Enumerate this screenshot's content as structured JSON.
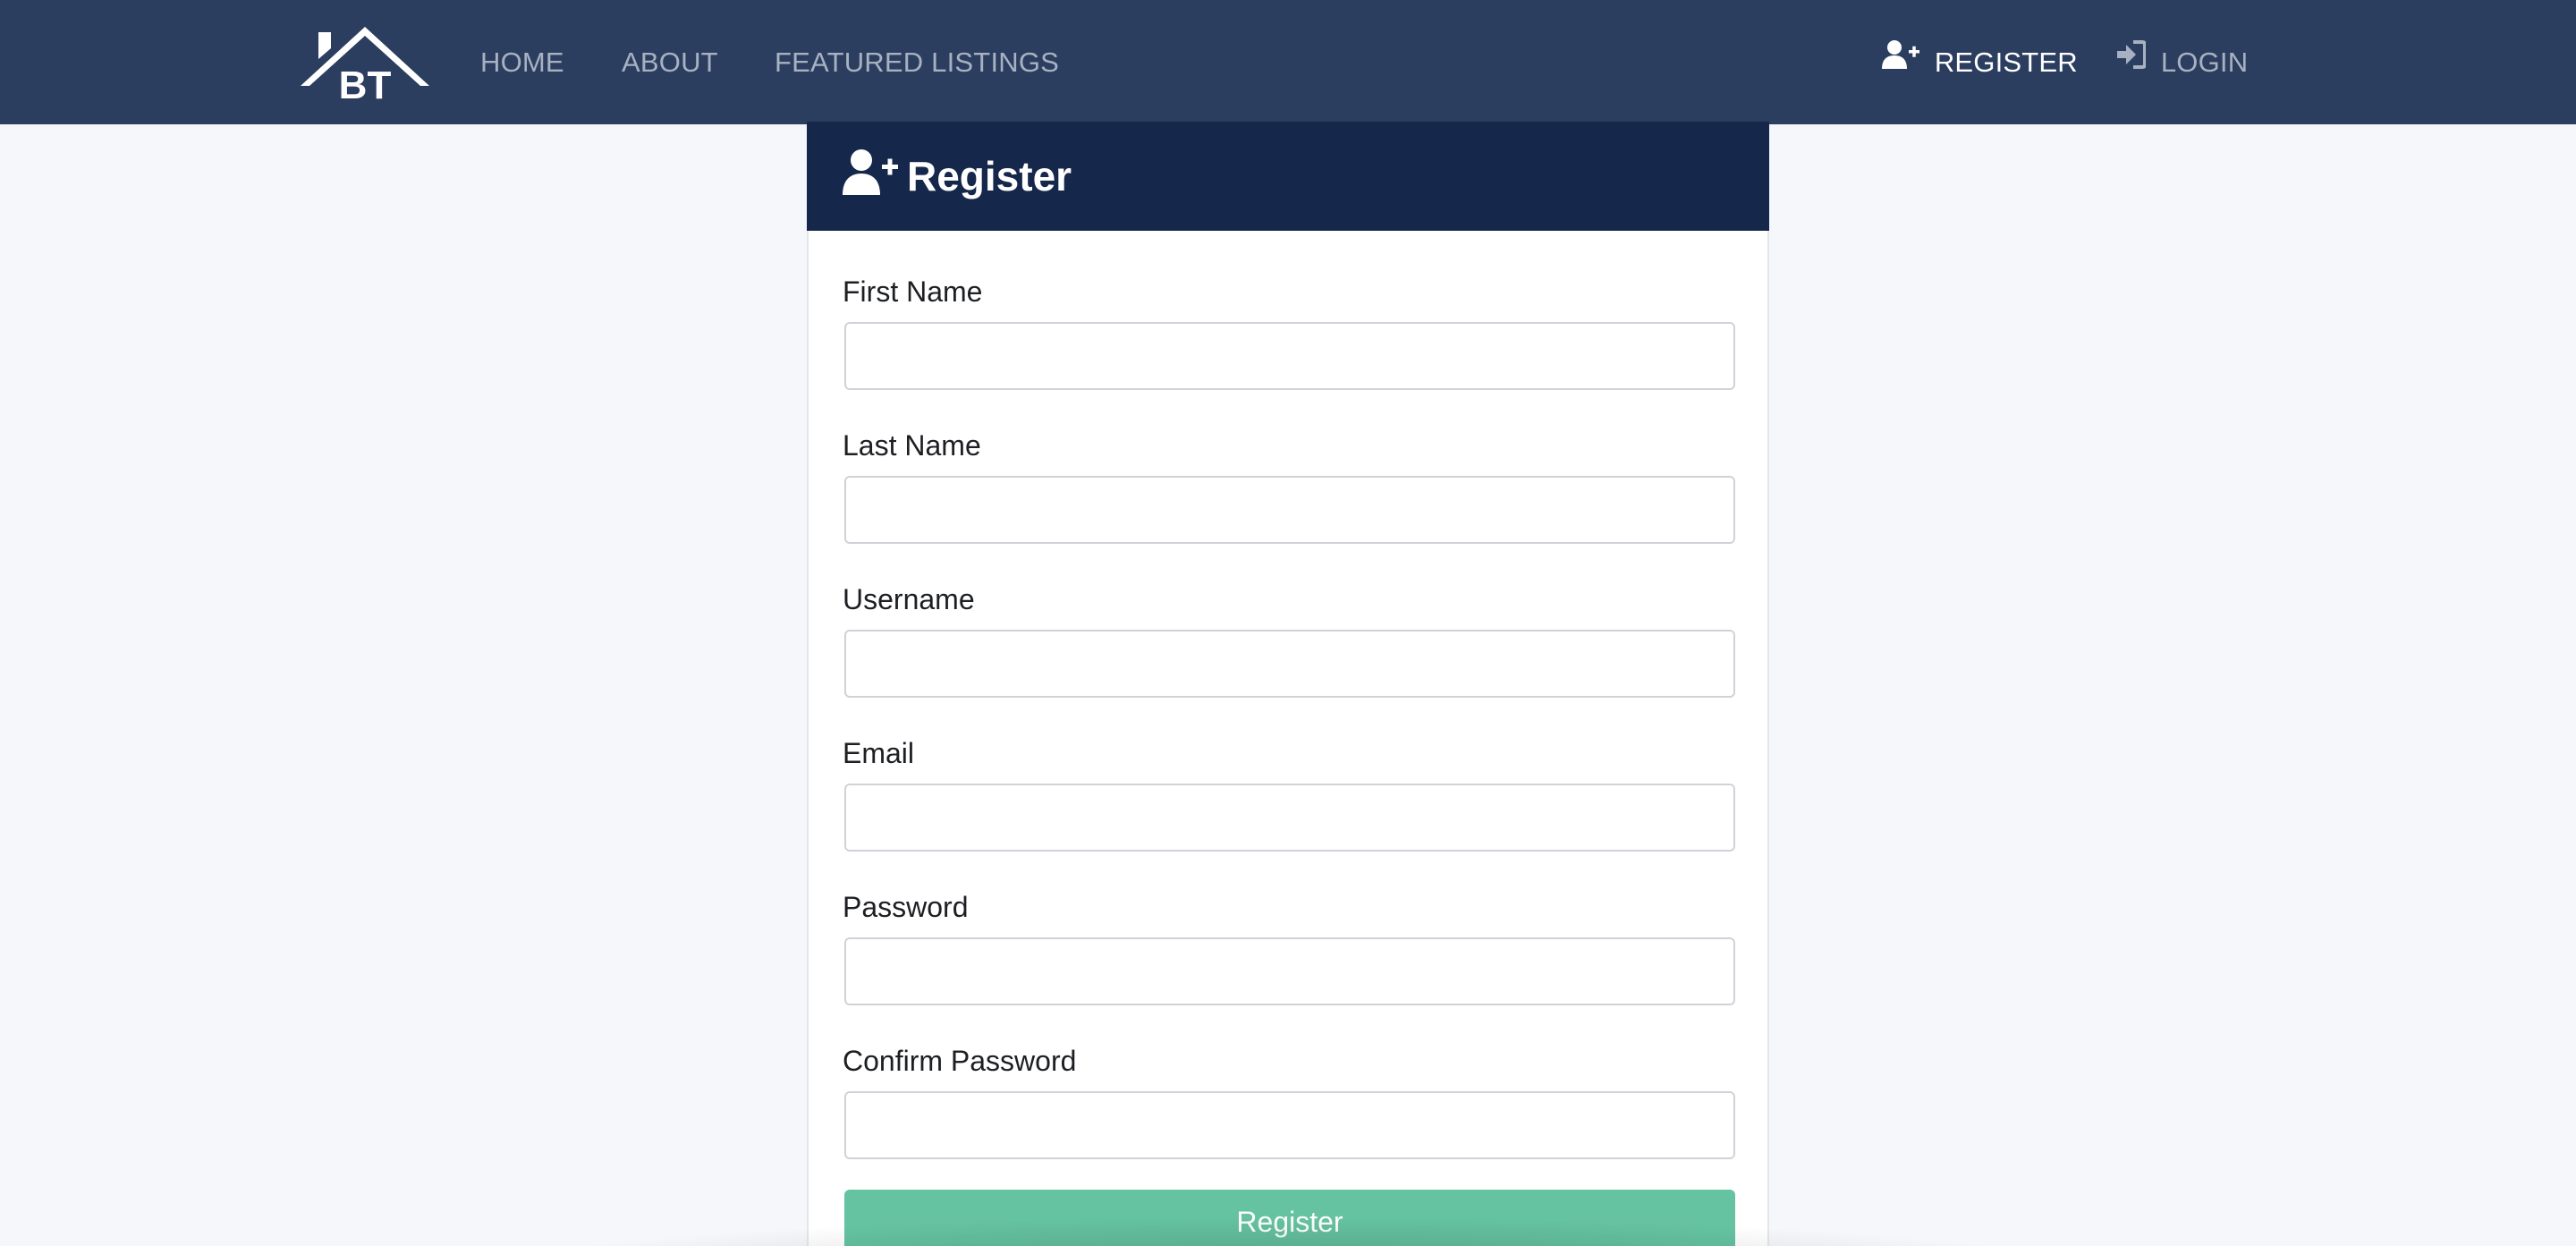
{
  "nav": {
    "logo_text": "BT",
    "home": "HOME",
    "about": "ABOUT",
    "featured": "FEATURED LISTINGS",
    "register": "REGISTER",
    "login": "LOGIN"
  },
  "form": {
    "title": "Register",
    "fields": [
      {
        "label": "First Name",
        "value": ""
      },
      {
        "label": "Last Name",
        "value": ""
      },
      {
        "label": "Username",
        "value": ""
      },
      {
        "label": "Email",
        "value": ""
      },
      {
        "label": "Password",
        "value": ""
      },
      {
        "label": "Confirm Password",
        "value": ""
      }
    ],
    "submit": "Register"
  },
  "colors": {
    "navbar": "#2c3e5f",
    "card_header": "#15274b",
    "submit": "#65c3a1",
    "nav_inactive": "#a7b1c1",
    "nav_active": "#ffffff"
  },
  "icons": {
    "register": "user-plus-icon",
    "login": "sign-in-icon"
  }
}
